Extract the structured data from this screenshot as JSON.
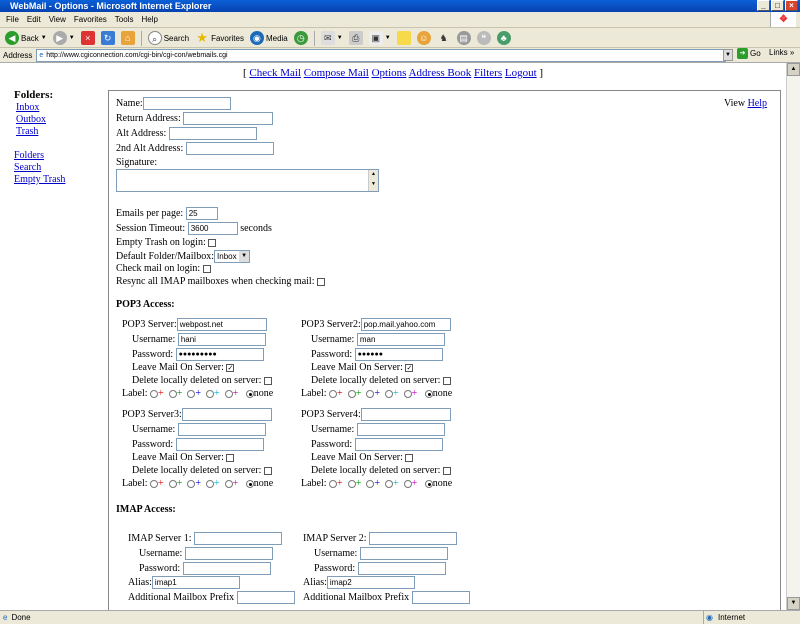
{
  "window": {
    "title": "WebMail - Options - Microsoft Internet Explorer"
  },
  "menu": [
    "File",
    "Edit",
    "View",
    "Favorites",
    "Tools",
    "Help"
  ],
  "toolbar": {
    "back": "Back",
    "search": "Search",
    "favorites": "Favorites",
    "media": "Media"
  },
  "address": {
    "label": "Address",
    "url": "http://www.cgiconnection.com/cgi-bin/cgi-con/webmails.cgi",
    "go": "Go",
    "links": "Links"
  },
  "status": {
    "left": "Done",
    "zone": "Internet"
  },
  "nav": {
    "items": [
      "Check Mail",
      "Compose Mail",
      "Options",
      "Address Book",
      "Filters",
      "Logout"
    ]
  },
  "sidebar": {
    "heading": "Folders:",
    "folders": [
      "Inbox",
      "Outbox",
      "Trash"
    ],
    "actions": [
      "Folders",
      "Search",
      "Empty Trash"
    ]
  },
  "help": {
    "prefix": "View",
    "link": "Help"
  },
  "identity": {
    "name_label": "Name:",
    "name_value": "",
    "return_label": "Return Address:",
    "return_value": "",
    "alt_label": "Alt Address:",
    "alt_value": "",
    "alt2_label": "2nd Alt Address:",
    "alt2_value": "",
    "signature_label": "Signature:"
  },
  "settings": {
    "emails_per_page_label": "Emails per page:",
    "emails_per_page": "25",
    "timeout_label": "Session Timeout:",
    "timeout": "3600",
    "timeout_unit": "seconds",
    "empty_trash_label": "Empty Trash on login:",
    "default_folder_label": "Default Folder/Mailbox:",
    "default_folder": "Inbox",
    "check_mail_label": "Check mail on login:",
    "resync_label": "Resync all IMAP mailboxes when checking mail:"
  },
  "pop3": {
    "heading": "POP3 Access:",
    "username_label": "Username:",
    "password_label": "Password:",
    "leave_label": "Leave Mail On Server:",
    "delete_label": "Delete locally deleted on server:",
    "label_label": "Label:",
    "none_label": "none",
    "servers": [
      {
        "label": "POP3 Server:",
        "server": "webpost.net",
        "username": "hani",
        "password": "●●●●●●●●●",
        "leave": true
      },
      {
        "label": "POP3 Server2:",
        "server": "pop.mail.yahoo.com",
        "username": "man",
        "password": "●●●●●●",
        "leave": true
      },
      {
        "label": "POP3 Server3:",
        "server": "",
        "username": "",
        "password": "",
        "leave": false
      },
      {
        "label": "POP3 Server4:",
        "server": "",
        "username": "",
        "password": "",
        "leave": false
      }
    ]
  },
  "imap": {
    "heading": "IMAP Access:",
    "username_label": "Username:",
    "password_label": "Password:",
    "alias_label": "Alias:",
    "prefix_label": "Additional Mailbox Prefix",
    "servers": [
      {
        "label": "IMAP Server 1:",
        "alias": "imap1"
      },
      {
        "label": "IMAP Server 2:",
        "alias": "imap2"
      }
    ]
  },
  "colors": {
    "red": "#e00000",
    "green": "#00a000",
    "blue": "#0000e0",
    "cyan": "#00b0d0",
    "magenta": "#c000c0"
  }
}
